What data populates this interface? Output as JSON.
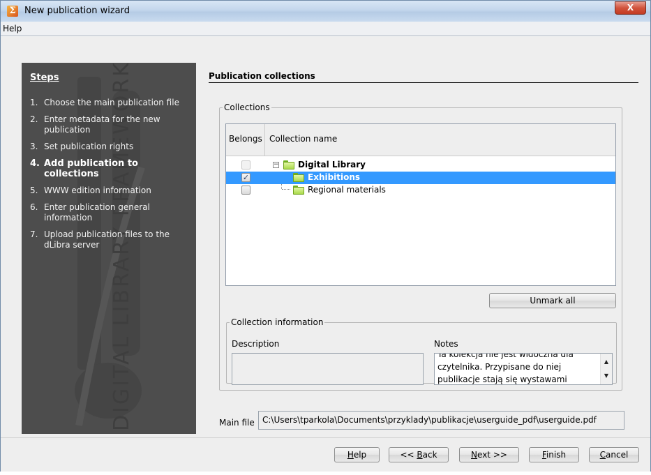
{
  "window": {
    "title": "New publication wizard",
    "close_glyph": "X",
    "app_icon": "dlibra-app-icon",
    "icon_letter": "Σ"
  },
  "menu": {
    "help": "Help"
  },
  "steps": {
    "title": "Steps",
    "watermark": "DIGITAL LIBRARY FRAMEWORK",
    "items": [
      {
        "num": "1.",
        "label": "Choose the main publication file",
        "active": false
      },
      {
        "num": "2.",
        "label": "Enter metadata for the new publication",
        "active": false
      },
      {
        "num": "3.",
        "label": "Set publication rights",
        "active": false
      },
      {
        "num": "4.",
        "label": "Add publication to collections",
        "active": true
      },
      {
        "num": "5.",
        "label": "WWW edition information",
        "active": false
      },
      {
        "num": "6.",
        "label": "Enter publication general information",
        "active": false
      },
      {
        "num": "7.",
        "label": "Upload publication files to the dLibra server",
        "active": false
      }
    ]
  },
  "section": {
    "title": "Publication collections"
  },
  "collections": {
    "legend": "Collections",
    "headers": {
      "belongs": "Belongs",
      "name": "Collection name"
    },
    "rows": [
      {
        "name": "Digital Library",
        "checked": false,
        "enabled": false,
        "selected": false,
        "bold": true,
        "expander": "−"
      },
      {
        "name": "Exhibitions",
        "checked": true,
        "enabled": true,
        "selected": true,
        "bold": true
      },
      {
        "name": "Regional materials",
        "checked": false,
        "enabled": true,
        "selected": false,
        "bold": false
      }
    ],
    "check_glyph": "✓",
    "unmark_label": "Unmark all"
  },
  "collection_info": {
    "legend": "Collection information",
    "description_label": "Description",
    "notes_label": "Notes",
    "notes_text": "Ta kolekcja nie jest widoczna dla czytelnika. Przypisane do niej publikacje stają się wystawami",
    "scroll_up_glyph": "▲",
    "scroll_down_glyph": "▼"
  },
  "main_file": {
    "label": "Main file",
    "value": "C:\\Users\\tparkola\\Documents\\przyklady\\publikacje\\userguide_pdf\\userguide.pdf"
  },
  "buttons": {
    "help": {
      "mnemonic": "H",
      "rest": "elp"
    },
    "back": {
      "pre": "<< ",
      "mnemonic": "B",
      "rest": "ack"
    },
    "next": {
      "mnemonic": "N",
      "rest": "ext >>"
    },
    "finish": {
      "mnemonic": "F",
      "rest": "inish"
    },
    "cancel": {
      "mnemonic": "C",
      "rest": "ancel"
    }
  },
  "colors": {
    "selection": "#3399ff",
    "steps_panel": "#4d4d4d",
    "folder_green": "#a9d94a"
  }
}
